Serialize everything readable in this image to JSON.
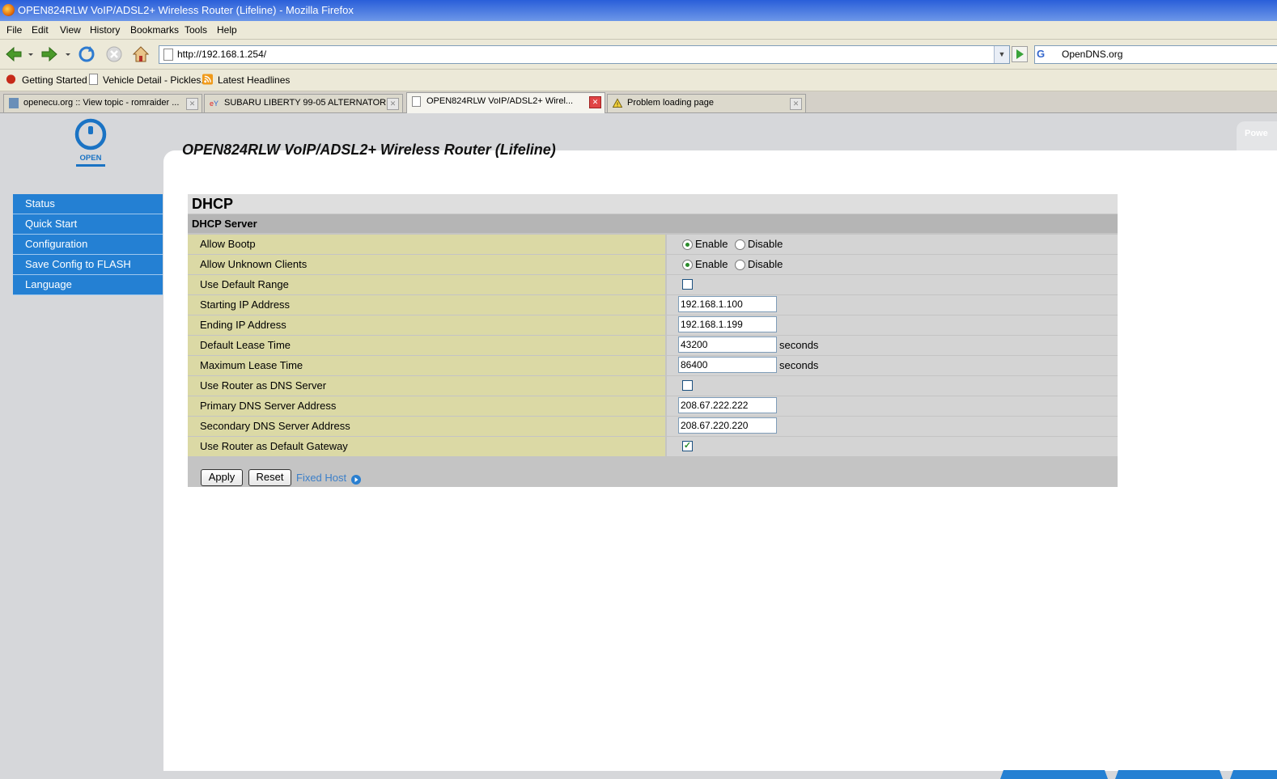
{
  "window": {
    "title": "OPEN824RLW VoIP/ADSL2+ Wireless Router (Lifeline) - Mozilla Firefox"
  },
  "menu": [
    "File",
    "Edit",
    "View",
    "History",
    "Bookmarks",
    "Tools",
    "Help"
  ],
  "nav": {
    "url": "http://192.168.1.254/",
    "search_engine": "G",
    "search_text": "OpenDNS.org"
  },
  "bookmarks": [
    "Getting Started",
    "Vehicle Detail - Pickles...",
    "Latest Headlines"
  ],
  "tabs": [
    {
      "label": "openecu.org :: View topic - romraider ...",
      "active": false
    },
    {
      "label": "SUBARU LIBERTY 99-05 ALTERNATOR...",
      "active": false
    },
    {
      "label": "OPEN824RLW VoIP/ADSL2+ Wirel...",
      "active": true
    },
    {
      "label": "Problem loading page",
      "active": false
    }
  ],
  "router": {
    "logo_text": "OPEN",
    "page_title": "OPEN824RLW VoIP/ADSL2+ Wireless Router (Lifeline)",
    "powered_label": "Powe"
  },
  "sidebar": [
    "Status",
    "Quick Start",
    "Configuration",
    "Save Config to FLASH",
    "Language"
  ],
  "form": {
    "section_title": "DHCP",
    "subsection_title": "DHCP Server",
    "enable_label": "Enable",
    "disable_label": "Disable",
    "seconds_label": "seconds",
    "rows": [
      {
        "label": "Allow Bootp",
        "type": "radio",
        "value": "Enable"
      },
      {
        "label": "Allow Unknown Clients",
        "type": "radio",
        "value": "Enable"
      },
      {
        "label": "Use Default Range",
        "type": "checkbox",
        "checked": false
      },
      {
        "label": "Starting IP Address",
        "type": "text",
        "value": "192.168.1.100"
      },
      {
        "label": "Ending IP Address",
        "type": "text",
        "value": "192.168.1.199"
      },
      {
        "label": "Default Lease Time",
        "type": "text",
        "value": "43200",
        "unit": "seconds"
      },
      {
        "label": "Maximum Lease Time",
        "type": "text",
        "value": "86400",
        "unit": "seconds"
      },
      {
        "label": "Use Router as DNS Server",
        "type": "checkbox",
        "checked": false
      },
      {
        "label": "Primary DNS Server Address",
        "type": "text",
        "value": "208.67.222.222"
      },
      {
        "label": "Secondary DNS Server Address",
        "type": "text",
        "value": "208.67.220.220"
      },
      {
        "label": "Use Router as Default Gateway",
        "type": "checkbox",
        "checked": true
      }
    ],
    "apply_label": "Apply",
    "reset_label": "Reset",
    "fixed_host_label": "Fixed Host"
  },
  "colors": {
    "nav_blue": "#2480d3",
    "label_cell": "#dbd9a5",
    "value_cell": "#d4d4d4",
    "link": "#3b7fc9"
  }
}
